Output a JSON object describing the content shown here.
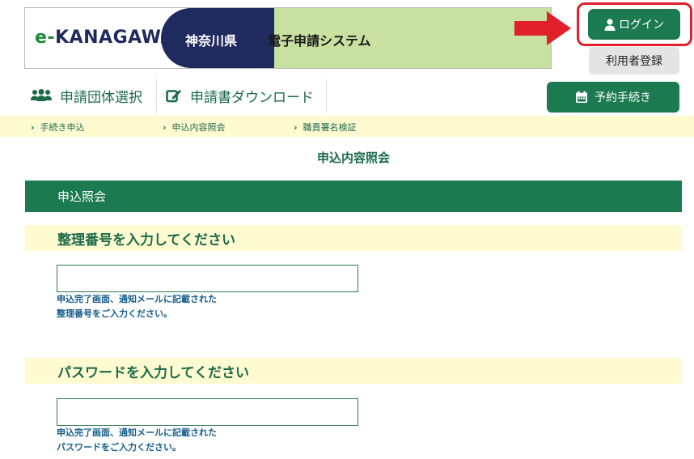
{
  "header": {
    "logo_prefix": "e-",
    "logo_main": "KANAGAWA",
    "prefecture": "神奈川県",
    "system_name": "電子申請システム",
    "login_label": "ログイン",
    "register_label": "利用者登録"
  },
  "nav": {
    "items": [
      {
        "label": "申請団体選択",
        "icon": "group-icon"
      },
      {
        "label": "申請書ダウンロード",
        "icon": "edit-icon"
      }
    ],
    "reserve_label": "予約手続き",
    "reserve_icon": "calendar-icon"
  },
  "breadcrumbs": [
    {
      "label": "手続き申込"
    },
    {
      "label": "申込内容照会"
    },
    {
      "label": "職責署名検証"
    }
  ],
  "page_title": "申込内容照会",
  "section_title": "申込照会",
  "fields": [
    {
      "label": "整理番号を入力してください",
      "value": "",
      "hint_line1": "申込完了画面、通知メールに記載された",
      "hint_line2": "整理番号をご入力ください。"
    },
    {
      "label": "パスワードを入力してください",
      "value": "",
      "hint_line1": "申込完了画面、通知メールに記載された",
      "hint_line2": "パスワードをご入力ください。"
    }
  ],
  "colors": {
    "primary_green": "#1b7a4f",
    "highlight_yellow": "#fffbd1",
    "logo_navy": "#1f2a5e",
    "logo_light_green": "#c8e0a0",
    "callout_red": "#e0202a"
  }
}
